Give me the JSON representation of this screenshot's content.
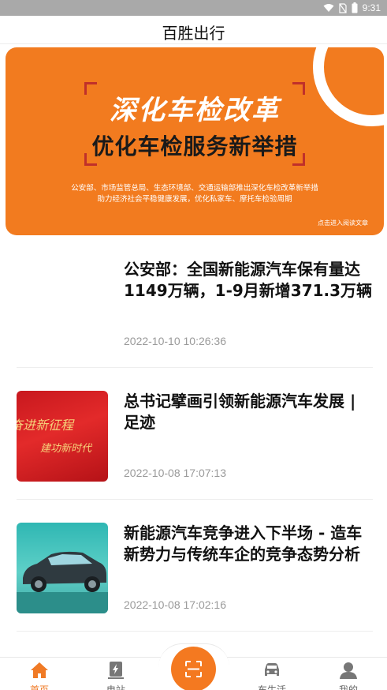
{
  "status_bar": {
    "time": "9:31",
    "icons": [
      "wifi-icon",
      "no-sim-icon",
      "battery-icon"
    ]
  },
  "header": {
    "title": "百胜出行"
  },
  "banner": {
    "headline": "深化车检改革",
    "subheadline": "优化车检服务新举措",
    "description_line1": "公安部、市场监管总局、生态环境部、交通运输部推出深化车检改革新举措",
    "description_line2": "助力经济社会平稳健康发展，优化私家车、摩托车检验周期",
    "link_text": "点击进入阅读文章",
    "accent_color": "#f27b1f"
  },
  "news": {
    "items": [
      {
        "title": "公安部：全国新能源汽车保有量达1149万辆，1-9月新增371.3万辆",
        "date": "2022-10-10 10:26:36",
        "thumbnail": "none"
      },
      {
        "title": "总书记擘画引领新能源汽车发展 | 足迹",
        "date": "2022-10-08 17:07:13",
        "thumbnail": "red-banner",
        "thumb_text_1": "奋进新征程",
        "thumb_text_2": "建功新时代"
      },
      {
        "title": "新能源汽车竞争进入下半场 - 造车新势力与传统车企的竞争态势分析",
        "date": "2022-10-08 17:02:16",
        "thumbnail": "car-photo"
      }
    ]
  },
  "tab_bar": {
    "tabs": [
      {
        "label": "首页",
        "icon": "home-icon",
        "active": true
      },
      {
        "label": "电站",
        "icon": "charging-station-icon",
        "active": false
      },
      {
        "label": "",
        "icon": "scan-icon",
        "active": false
      },
      {
        "label": "车生活",
        "icon": "car-icon",
        "active": false
      },
      {
        "label": "我的",
        "icon": "person-icon",
        "active": false
      }
    ],
    "active_color": "#f07a25"
  }
}
